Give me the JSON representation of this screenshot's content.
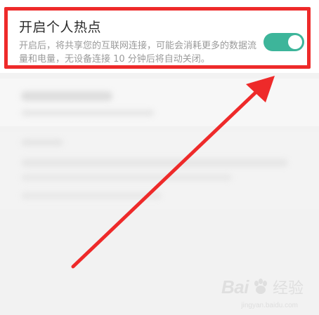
{
  "hotspot": {
    "title": "开启个人热点",
    "description": "开启后，将共享您的互联网连接，可能会消耗更多的数据流量和电量，无设备连接 10 分钟后将自动关闭。",
    "toggle_on": true
  },
  "watermark": {
    "logo": "Bai",
    "text": "经验",
    "url": "jingyan.baidu.com"
  },
  "colors": {
    "accent": "#3db59a",
    "highlight": "#ee2a2a"
  }
}
